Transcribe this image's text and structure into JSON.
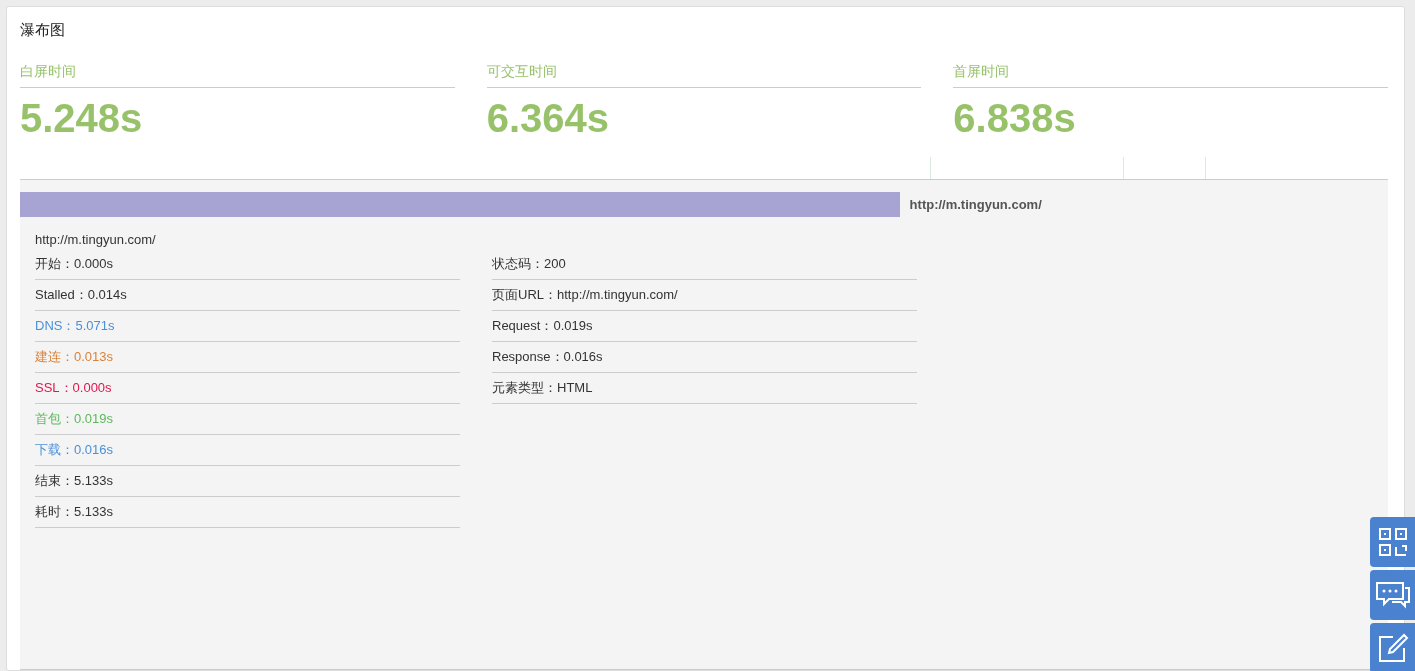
{
  "panel": {
    "title": "瀑布图"
  },
  "metrics": [
    {
      "label": "白屏时间",
      "value": "5.248s"
    },
    {
      "label": "可交互时间",
      "value": "6.364s"
    },
    {
      "label": "首屏时间",
      "value": "6.838s"
    }
  ],
  "waterfall": {
    "bar": {
      "level": 0.643,
      "label": "http://m.tingyun.com/"
    },
    "detail": {
      "url": "http://m.tingyun.com/",
      "timings": [
        {
          "text": "开始：0.000s",
          "color": "#333333"
        },
        {
          "text": "Stalled：0.014s",
          "color": "#333333"
        },
        {
          "text": "DNS：5.071s",
          "color": "#4a90d9"
        },
        {
          "text": "建连：0.013s",
          "color": "#d9823b"
        },
        {
          "text": "SSL：0.000s",
          "color": "#e0174d"
        },
        {
          "text": "首包：0.019s",
          "color": "#5cb85c"
        },
        {
          "text": "下载：0.016s",
          "color": "#4a90d9"
        },
        {
          "text": "结束：5.133s",
          "color": "#333333"
        },
        {
          "text": "耗时：5.133s",
          "color": "#333333"
        }
      ],
      "info": [
        "状态码：200",
        "页面URL：http://m.tingyun.com/",
        "Request：0.019s",
        "Response：0.016s",
        "元素类型：HTML"
      ]
    }
  },
  "side_buttons": [
    {
      "kind": "qr"
    },
    {
      "kind": "chat"
    },
    {
      "kind": "edit"
    }
  ]
}
